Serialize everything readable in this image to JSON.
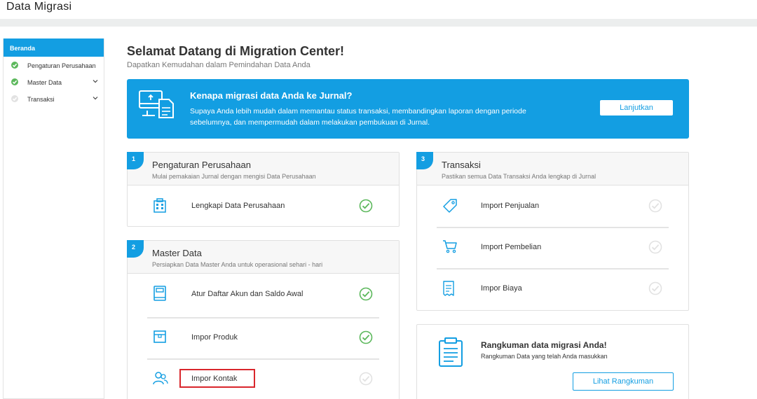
{
  "app": {
    "title": "Data Migrasi"
  },
  "sidebar": {
    "home": "Beranda",
    "items": [
      {
        "label": "Pengaturan Perusahaan",
        "done": true,
        "expandable": false
      },
      {
        "label": "Master Data",
        "done": true,
        "expandable": true
      },
      {
        "label": "Transaksi",
        "done": false,
        "expandable": true
      }
    ]
  },
  "main": {
    "title": "Selamat Datang di Migration Center!",
    "subtitle": "Dapatkan Kemudahan dalam Pemindahan Data Anda"
  },
  "banner": {
    "title": "Kenapa migrasi data Anda ke Jurnal?",
    "text": "Supaya Anda lebih mudah dalam memantau status transaksi, membandingkan laporan dengan periode sebelumnya, dan mempermudah dalam melakukan pembukuan di Jurnal.",
    "button": "Lanjutkan"
  },
  "sections": [
    {
      "number": "1",
      "title": "Pengaturan Perusahaan",
      "subtitle": "Mulai pemakaian Jurnal dengan mengisi Data Perusahaan",
      "rows": [
        {
          "label": "Lengkapi Data Perusahaan",
          "icon": "building-icon",
          "done": true
        }
      ]
    },
    {
      "number": "2",
      "title": "Master Data",
      "subtitle": "Persiapkan Data Master Anda untuk operasional sehari - hari",
      "rows": [
        {
          "label": "Atur Daftar Akun dan Saldo Awal",
          "icon": "book-icon",
          "done": true
        },
        {
          "label": "Impor Produk",
          "icon": "box-icon",
          "done": true
        },
        {
          "label": "Impor Kontak",
          "icon": "contacts-icon",
          "done": false
        }
      ]
    },
    {
      "number": "3",
      "title": "Transaksi",
      "subtitle": "Pastikan semua Data Transaksi Anda lengkap di Jurnal",
      "rows": [
        {
          "label": "Import Penjualan",
          "icon": "tag-icon",
          "done": false
        },
        {
          "label": "Import Pembelian",
          "icon": "cart-icon",
          "done": false
        },
        {
          "label": "Impor Biaya",
          "icon": "receipt-icon",
          "done": false
        }
      ]
    }
  ],
  "summary": {
    "title": "Rangkuman data migrasi Anda!",
    "subtitle": "Rangkuman Data yang telah Anda masukkan",
    "button": "Lihat Rangkuman"
  },
  "colors": {
    "accent": "#139ee2",
    "success": "#5cb85c",
    "highlight": "#d9262c",
    "pending": "#e2e2e2"
  }
}
